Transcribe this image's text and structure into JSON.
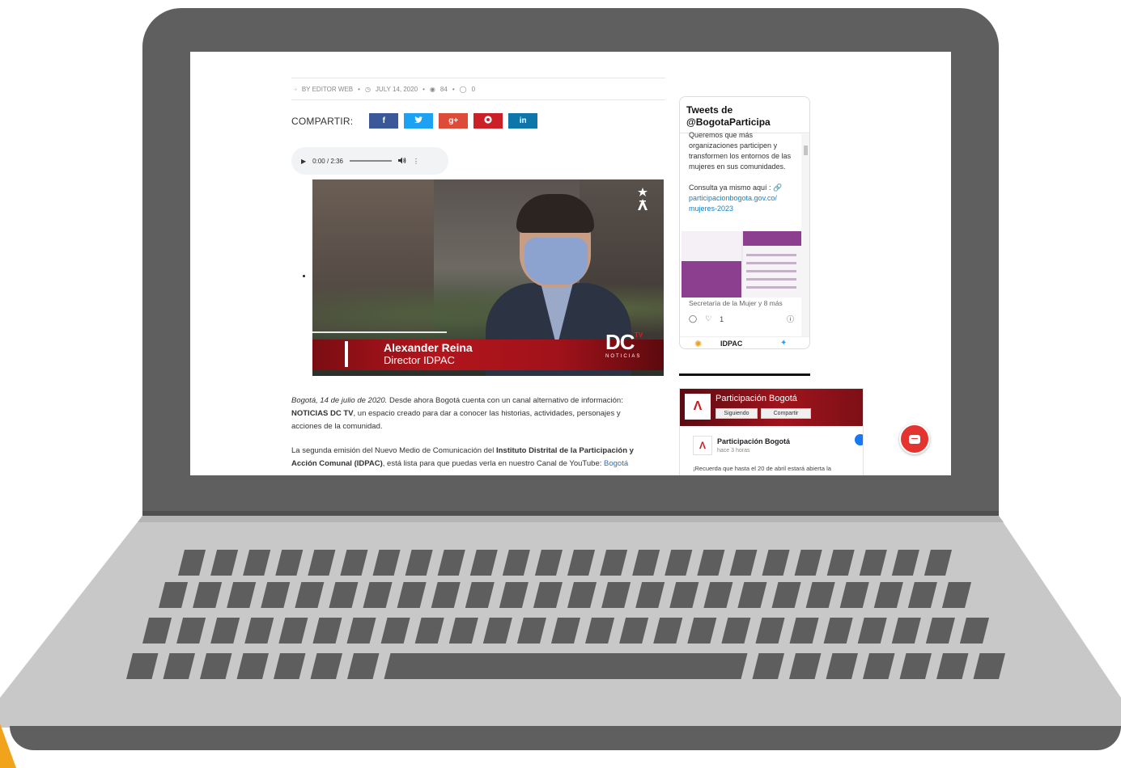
{
  "meta": {
    "by": "BY EDITOR WEB",
    "date": "JULY 14, 2020",
    "views": "84",
    "comments": "0"
  },
  "share": {
    "label": "COMPARTIR:",
    "buttons": [
      {
        "glyph": "f",
        "color": "#3b5998"
      },
      {
        "glyph": "t",
        "color": "#1da1f2"
      },
      {
        "glyph": "g+",
        "color": "#dd4b39"
      },
      {
        "glyph": "p",
        "color": "#cb2027"
      },
      {
        "glyph": "in",
        "color": "#0e76a8"
      }
    ]
  },
  "audio": {
    "time": "0:00 / 2:36"
  },
  "video": {
    "name": "Alexander Reina",
    "role": "Director IDPAC",
    "brand": "DC",
    "brand_sup": "TV",
    "brand_sub": "NOTICIAS"
  },
  "article": {
    "p1_date": "Bogotá, 14 de julio de 2020.",
    "p1_a": " Desde ahora Bogotá cuenta con un canal alternativo de información: ",
    "p1_bold": "NOTICIAS DC TV",
    "p1_b": ", un espacio creado para dar a conocer las historias, actividades, personajes y acciones de la comunidad.",
    "p2_a": "La segunda emisión del Nuevo Medio de Comunicación del ",
    "p2_bold": "Instituto Distrital de la Participación y Acción Comunal (IDPAC)",
    "p2_b": ", está lista para que puedas verla en nuestro Canal de YouTube: ",
    "p2_link": "Bogotá"
  },
  "twitter": {
    "title": "Tweets de @BogotaParticipa",
    "body_a": "Queremos que más organizaciones participen y transformen los entornos de las mujeres en sus comunidades.",
    "body_b": "Consulta ya mismo aquí :",
    "link": "participacionbogota.gov.co/ mujeres-2023",
    "caption": "Secretaría de la Mujer y 8 más",
    "likes": "1",
    "footer_name": "IDPAC"
  },
  "facebook": {
    "page_name": "Participación Bogotá",
    "follow_label": "Siguiendo",
    "share_label": "Compartir",
    "post_name": "Participación Bogotá",
    "post_time": "hace 3 horas",
    "post_text": "¡Recuerda que hasta el 20 de abril estará abierta la"
  },
  "icons": {
    "audio_play": "play-icon",
    "volume": "volume-icon",
    "chat": "chat-icon"
  }
}
